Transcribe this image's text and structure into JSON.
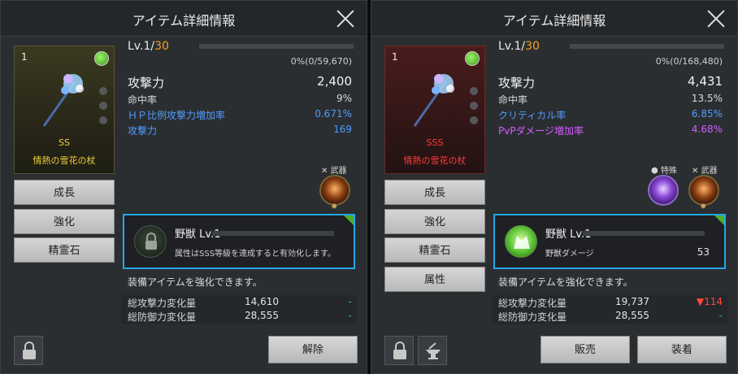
{
  "colors": {
    "accent": "#22a7e8",
    "max_level": "#f4a11a",
    "blue_stat": "#4f9cff",
    "purple_stat": "#d45cff",
    "ss_grade": "#f1cf3c",
    "sss_grade": "#ff3b3b",
    "pos_diff": "#2fbf80",
    "neg_diff": "#ff4a3a"
  },
  "left": {
    "title": "アイテム詳細情報",
    "card": {
      "count": "1",
      "grade": "SS",
      "name": "情熱の雪花の杖"
    },
    "menu": [
      "成長",
      "強化",
      "精霊石"
    ],
    "level_prefix": "Lv.1/",
    "level_max": "30",
    "xp_text": "0%(0/59,670)",
    "stats": [
      {
        "label": "攻撃力",
        "value": "2,400"
      },
      {
        "label": "命中率",
        "value": "9%"
      },
      {
        "label": "ＨＰ比例攻撃力増加率",
        "value": "0.671%"
      },
      {
        "label": "攻撃力",
        "value": "169"
      }
    ],
    "weapon_label": "✕ 武器",
    "pet": {
      "name": "野獣 Lv.1",
      "desc": "属性はSSS等級を達成すると有効化します。",
      "value": ""
    },
    "note": "装備アイテムを強化できます。",
    "compare": [
      {
        "label": "総攻撃力変化量",
        "value": "14,610",
        "diff": "-"
      },
      {
        "label": "総防御力変化量",
        "value": "28,555",
        "diff": "-"
      }
    ],
    "action": "解除"
  },
  "right": {
    "title": "アイテム詳細情報",
    "card": {
      "count": "1",
      "grade": "SSS",
      "name": "情熱の雪花の杖"
    },
    "menu": [
      "成長",
      "強化",
      "精霊石",
      "属性"
    ],
    "level_prefix": "Lv.1/",
    "level_max": "30",
    "xp_text": "0%(0/168,480)",
    "stats": [
      {
        "label": "攻撃力",
        "value": "4,431"
      },
      {
        "label": "命中率",
        "value": "13.5%"
      },
      {
        "label": "クリティカル率",
        "value": "6.85%"
      },
      {
        "label": "PvPダメージ増加率",
        "value": "4.68%"
      }
    ],
    "special_label": "⬢ 特殊",
    "weapon_label": "✕ 武器",
    "pet": {
      "name": "野獣 Lv.1",
      "desc": "野獣ダメージ",
      "value": "53"
    },
    "note": "装備アイテムを強化できます。",
    "compare": [
      {
        "label": "総攻撃力変化量",
        "value": "19,737",
        "diff": "▼114"
      },
      {
        "label": "総防御力変化量",
        "value": "28,555",
        "diff": "-"
      }
    ],
    "actions": [
      "販売",
      "装着"
    ]
  }
}
